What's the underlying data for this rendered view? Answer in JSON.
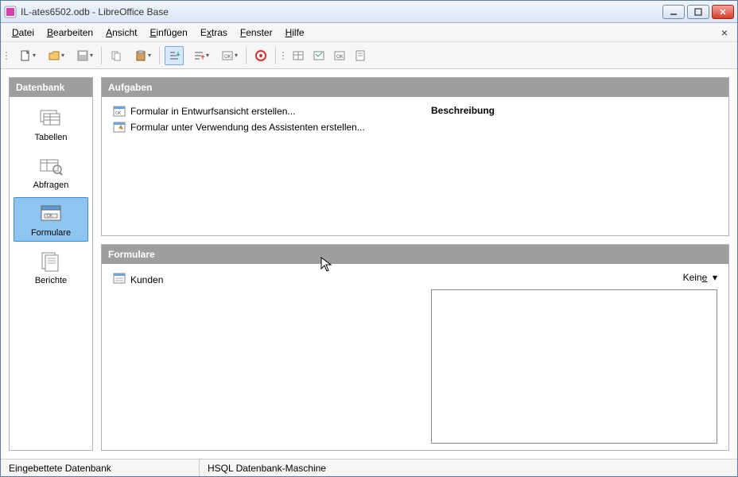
{
  "window": {
    "title": "IL-ates6502.odb - LibreOffice Base"
  },
  "menu": {
    "items": [
      {
        "label": "Datei",
        "u": 0
      },
      {
        "label": "Bearbeiten",
        "u": 0
      },
      {
        "label": "Ansicht",
        "u": 0
      },
      {
        "label": "Einfügen",
        "u": 0
      },
      {
        "label": "Extras",
        "u": 0
      },
      {
        "label": "Fenster",
        "u": 0
      },
      {
        "label": "Hilfe",
        "u": 0
      }
    ]
  },
  "sidebar": {
    "header": "Datenbank",
    "items": [
      {
        "label": "Tabellen"
      },
      {
        "label": "Abfragen"
      },
      {
        "label": "Formulare"
      },
      {
        "label": "Berichte"
      }
    ],
    "selected": 2
  },
  "tasks": {
    "header": "Aufgaben",
    "items": [
      {
        "pre": "Formular in Ent",
        "uchar": "w",
        "post": "urfsansicht erstellen..."
      },
      {
        "pre": "Formular ",
        "uchar": "u",
        "post": "nter Verwendung des Assistenten erstellen..."
      }
    ],
    "desc_label": "Beschreibung"
  },
  "objects": {
    "header": "Formulare",
    "items": [
      "Kunden"
    ],
    "view_label_pre": "Kein",
    "view_label_u": "e",
    "view_label_post": ""
  },
  "status": {
    "left": "Eingebettete Datenbank",
    "right": "HSQL Datenbank-Maschine"
  }
}
